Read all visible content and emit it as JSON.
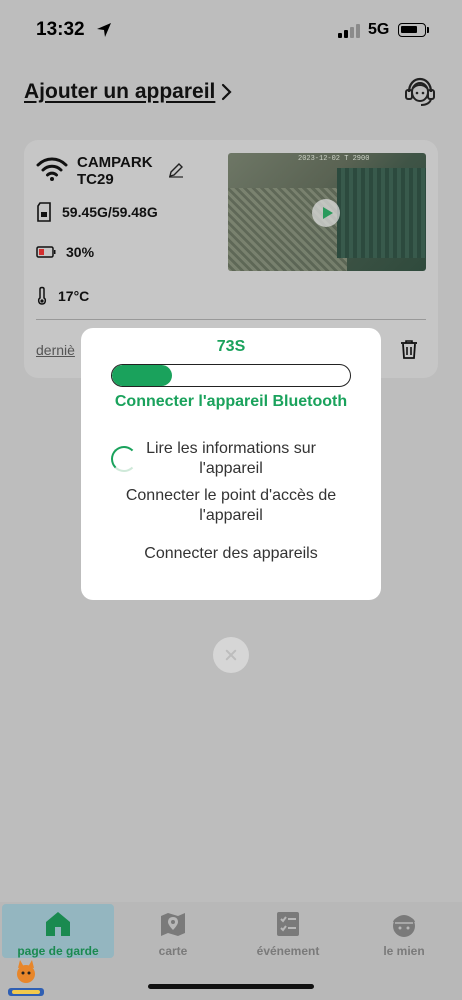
{
  "status_bar": {
    "time": "13:32",
    "network": "5G"
  },
  "header": {
    "add_device_label": "Ajouter un appareil"
  },
  "device": {
    "name": "CAMPARK TC29",
    "storage": "59.45G/59.48G",
    "battery": "30%",
    "temperature": "17°C",
    "last_link": "derniè",
    "thumbnail_stamp": "2023-12-02 T 2900"
  },
  "modal": {
    "countdown": "73S",
    "progress_fraction": 0.25,
    "steps": [
      {
        "label": "Connecter l'appareil Bluetooth",
        "state": "active"
      },
      {
        "label": "Lire les informations sur l'appareil",
        "state": "loading"
      },
      {
        "label": "Connecter le point d'accès de l'appareil",
        "state": "pending"
      },
      {
        "label": "Connecter des appareils",
        "state": "pending"
      }
    ]
  },
  "tabs": [
    {
      "label": "page de garde",
      "icon": "home-icon",
      "active": true
    },
    {
      "label": "carte",
      "icon": "map-pin-icon",
      "active": false
    },
    {
      "label": "événement",
      "icon": "event-icon",
      "active": false
    },
    {
      "label": "le mien",
      "icon": "profile-icon",
      "active": false
    }
  ],
  "colors": {
    "accent": "#1aa25c",
    "overlay": "#bdbdbd",
    "active_tab_bg": "#94b6c0"
  }
}
